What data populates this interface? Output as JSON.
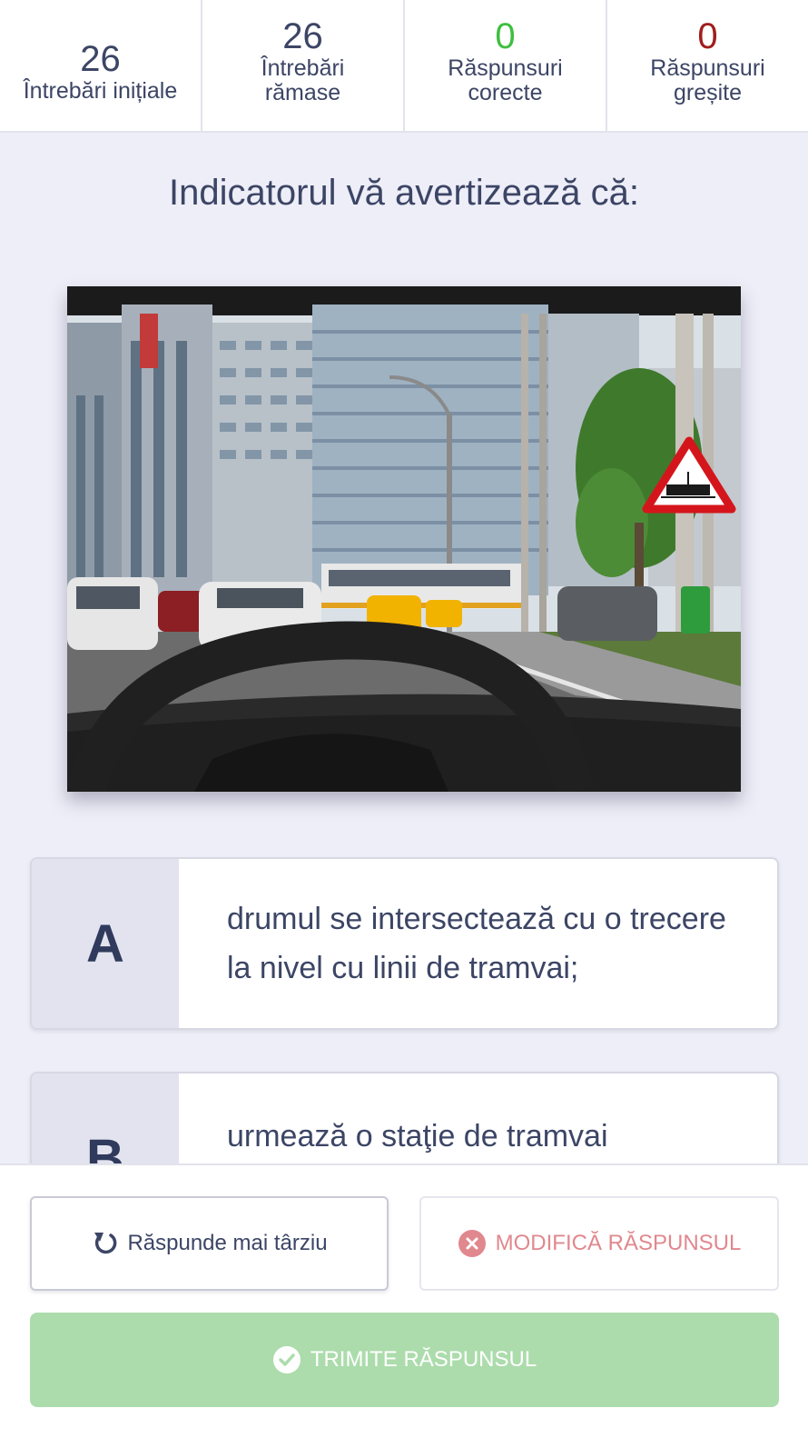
{
  "stats": {
    "initial": {
      "value": "26",
      "label": "Întrebări inițiale"
    },
    "remaining": {
      "value": "26",
      "label_line1": "Întrebări",
      "label_line2": "rămase"
    },
    "correct": {
      "value": "0",
      "label_line1": "Răspunsuri",
      "label_line2": "corecte"
    },
    "wrong": {
      "value": "0",
      "label_line1": "Răspunsuri",
      "label_line2": "greșite"
    }
  },
  "question": {
    "text": "Indicatorul vă avertizează că:"
  },
  "answers": [
    {
      "letter": "A",
      "text": "drumul se intersectează cu o trecere la nivel cu linii de tramvai;"
    },
    {
      "letter": "B",
      "text": "urmează o staţie de tramvai"
    }
  ],
  "actions": {
    "later_label": "Răspunde mai târziu",
    "modify_label": "MODIFICĂ RĂSPUNSUL",
    "submit_label": "TRIMITE RĂSPUNSUL"
  },
  "colors": {
    "correct": "#3fbf3f",
    "wrong": "#a11d1d",
    "submit_bg": "#acdcac",
    "modify_text": "#e0888e"
  },
  "icons": {
    "later": "refresh-icon",
    "modify": "close-circle-icon",
    "submit": "check-circle-icon"
  }
}
